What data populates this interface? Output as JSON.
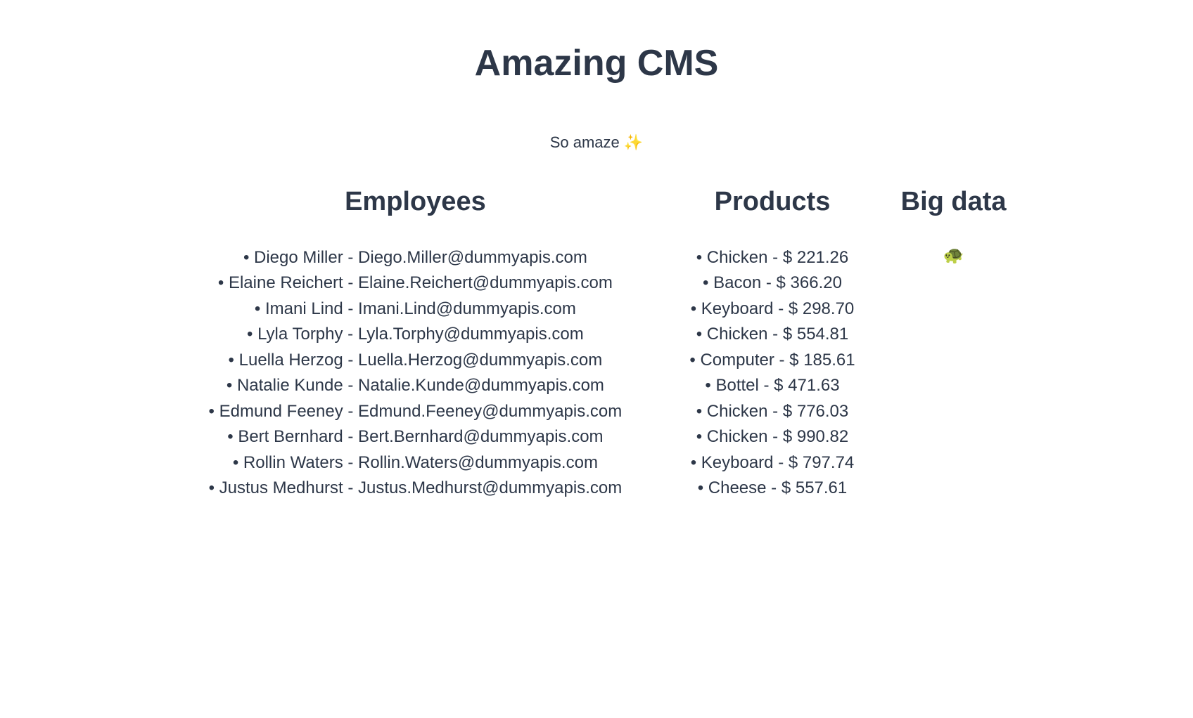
{
  "header": {
    "title": "Amazing CMS",
    "subtitle": "So amaze ✨"
  },
  "sections": {
    "employees": {
      "heading": "Employees",
      "items": [
        "Diego Miller - Diego.Miller@dummyapis.com",
        "Elaine Reichert - Elaine.Reichert@dummyapis.com",
        "Imani Lind - Imani.Lind@dummyapis.com",
        "Lyla Torphy - Lyla.Torphy@dummyapis.com",
        "Luella Herzog - Luella.Herzog@dummyapis.com",
        "Natalie Kunde - Natalie.Kunde@dummyapis.com",
        "Edmund Feeney - Edmund.Feeney@dummyapis.com",
        "Bert Bernhard - Bert.Bernhard@dummyapis.com",
        "Rollin Waters - Rollin.Waters@dummyapis.com",
        "Justus Medhurst - Justus.Medhurst@dummyapis.com"
      ]
    },
    "products": {
      "heading": "Products",
      "items": [
        "Chicken - $ 221.26",
        "Bacon - $ 366.20",
        "Keyboard - $ 298.70",
        "Chicken - $ 554.81",
        "Computer - $ 185.61",
        "Bottel - $ 471.63",
        "Chicken - $ 776.03",
        "Chicken - $ 990.82",
        "Keyboard - $ 797.74",
        "Cheese - $ 557.61"
      ]
    },
    "bigdata": {
      "heading": "Big data",
      "content": "🐢"
    }
  }
}
